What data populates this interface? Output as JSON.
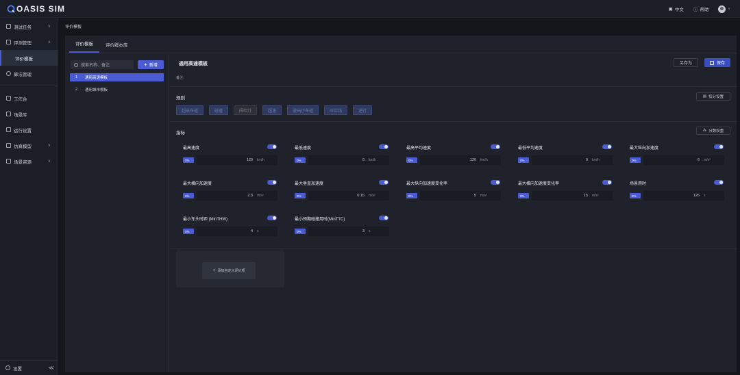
{
  "app": {
    "logo_text": "OASIS SIM"
  },
  "topbar": {
    "lang_label": "中文",
    "help_label": "帮助"
  },
  "sidebar": {
    "items": [
      {
        "label": "测试任务",
        "chevron": "∨"
      },
      {
        "label": "评测管理",
        "chevron": "∧"
      },
      {
        "label": "评价模板"
      },
      {
        "label": "算法管理"
      },
      {
        "label": "工作台"
      },
      {
        "label": "场景库"
      },
      {
        "label": "运行设置"
      },
      {
        "label": "仿真模型",
        "chevron": "∨"
      },
      {
        "label": "场景资源",
        "chevron": "∨"
      }
    ],
    "bottom_label": "设置",
    "collapse_glyph": "≪"
  },
  "breadcrumb": "评价模板",
  "tabs": [
    {
      "label": "评价模板"
    },
    {
      "label": "评价脚本库"
    }
  ],
  "left": {
    "search_placeholder": "搜索名称、备注",
    "add_label": "新增",
    "templates": [
      {
        "num": "1",
        "name": "通用高速模板"
      },
      {
        "num": "2",
        "name": "通用城市模板"
      }
    ]
  },
  "right": {
    "title": "通用高速模板",
    "remark_label": "备注:",
    "saveas_label": "另存为",
    "save_label": "保存",
    "rules_title": "规则",
    "rules_btn": "扣分设置",
    "rules": [
      "超出车道",
      "碰撞",
      "闯红灯",
      "超速",
      "驶出行车道",
      "压实线",
      "逆行"
    ],
    "metrics_title": "指标",
    "metrics_btn": "分数权重",
    "metrics": [
      {
        "name": "最高速度",
        "pct": "0%",
        "value": "120",
        "unit": "km/h"
      },
      {
        "name": "最低速度",
        "pct": "0%",
        "value": "0",
        "unit": "km/h"
      },
      {
        "name": "最高平均速度",
        "pct": "0%",
        "value": "120",
        "unit": "km/h"
      },
      {
        "name": "最低平均速度",
        "pct": "0%",
        "value": "0",
        "unit": "km/h"
      },
      {
        "name": "最大纵向加速度",
        "pct": "0%",
        "value": "6",
        "unit": "m/s²"
      },
      {
        "name": "最大横向加速度",
        "pct": "0%",
        "value": "2.3",
        "unit": "m/s²"
      },
      {
        "name": "最大垂直加速度",
        "pct": "0%",
        "value": "0.15",
        "unit": "m/s²"
      },
      {
        "name": "最大纵向加速度变化率",
        "pct": "0%",
        "value": "5",
        "unit": "m/s³"
      },
      {
        "name": "最大横向加速度变化率",
        "pct": "0%",
        "value": "15",
        "unit": "m/s³"
      },
      {
        "name": "场景用时",
        "pct": "0%",
        "value": "126",
        "unit": "s"
      },
      {
        "name": "最小车头时距 (MinTHW)",
        "pct": "0%",
        "value": "4",
        "unit": "s"
      },
      {
        "name": "最小预期碰撞用时(MinTTC)",
        "pct": "0%",
        "value": "3",
        "unit": "s"
      }
    ],
    "custom_label": "添加自定义评价项"
  }
}
